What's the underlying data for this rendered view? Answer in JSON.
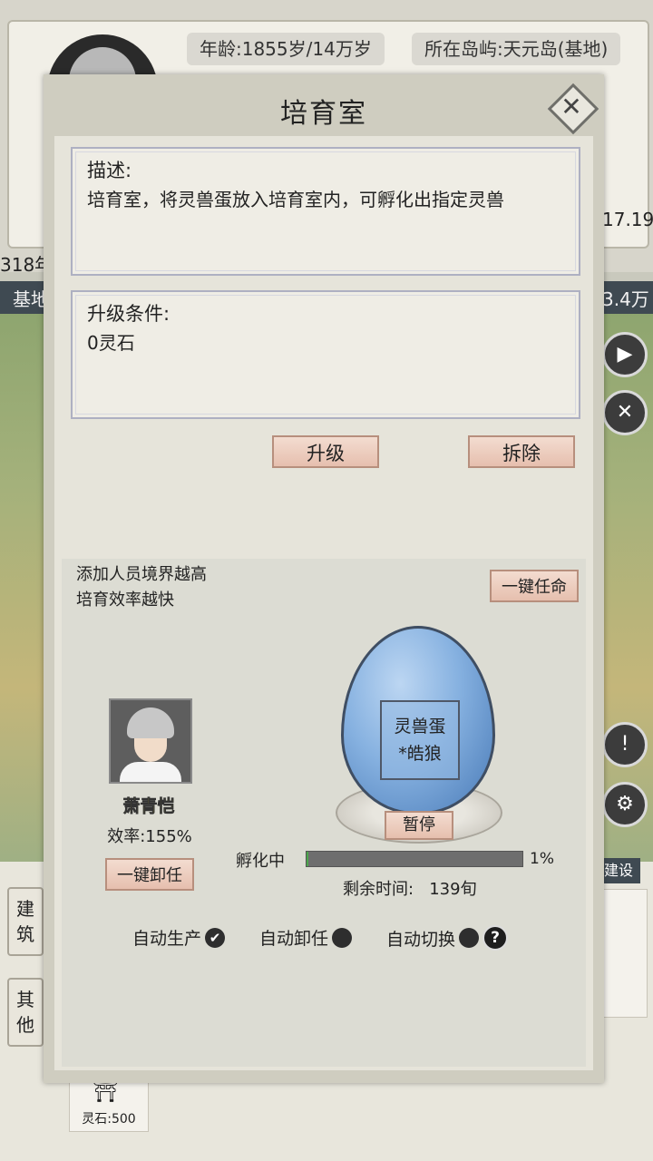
{
  "background": {
    "age": "年龄:1855岁/14万岁",
    "island": "所在岛屿:天元岛(基地)",
    "year_fragment": "318年",
    "base_fragment": "基地",
    "value_fragment": "17.19",
    "amount_fragment": "3.4万",
    "tabs": [
      "建\n筑",
      "其\n他"
    ],
    "build_label": "建设",
    "card_cost": "灵石:500"
  },
  "modal": {
    "title": "培育室",
    "description_header": "描述:",
    "description_text": "培育室，将灵兽蛋放入培育室内，可孵化出指定灵兽",
    "upgrade_header": "升级条件:",
    "upgrade_text": "0灵石",
    "upgrade_button": "升级",
    "demolish_button": "拆除",
    "tip_line1": "添加人员境界越高",
    "tip_line2": "培育效率越快",
    "appoint_all_button": "一键任命",
    "person": {
      "name": "萧青恺",
      "efficiency": "效率:155%",
      "dismiss_button": "一键卸任"
    },
    "egg": {
      "label_line1": "灵兽蛋",
      "label_line2": "*皓狼",
      "pause_button": "暂停",
      "status": "孵化中",
      "progress_text": "1%",
      "progress_fraction": 0.01,
      "remaining": "剩余时间:   139旬"
    },
    "toggles": {
      "auto_produce": "自动生产",
      "auto_dismiss": "自动卸任",
      "auto_switch": "自动切换"
    }
  }
}
